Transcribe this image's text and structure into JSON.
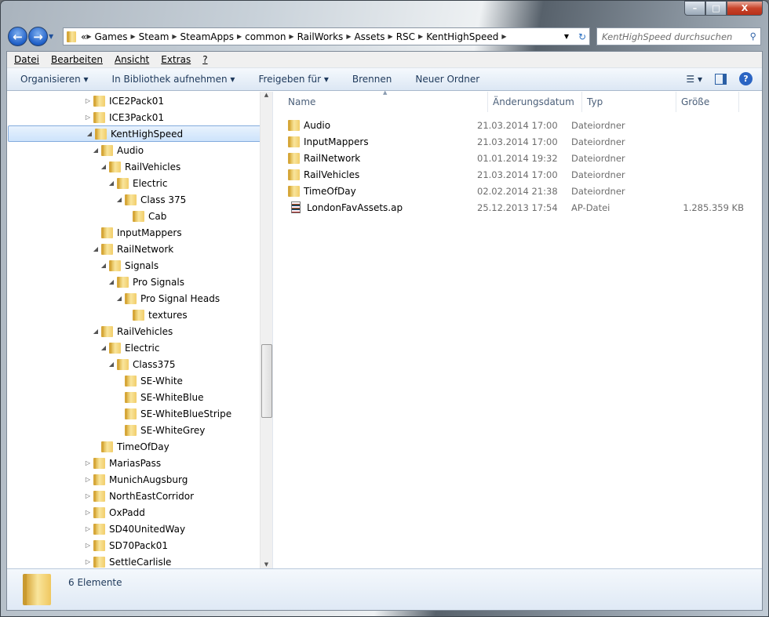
{
  "window": {
    "minimize": "–",
    "maximize": "□",
    "close": "X"
  },
  "nav": {
    "back": "←",
    "forward": "→"
  },
  "address": {
    "prefix": "«",
    "crumbs": [
      "Games",
      "Steam",
      "SteamApps",
      "common",
      "RailWorks",
      "Assets",
      "RSC",
      "KentHighSpeed"
    ]
  },
  "search": {
    "placeholder": "KentHighSpeed durchsuchen"
  },
  "menu": [
    "Datei",
    "Bearbeiten",
    "Ansicht",
    "Extras",
    "?"
  ],
  "toolbar": {
    "organize": "Organisieren ▾",
    "library": "In Bibliothek aufnehmen ▾",
    "share": "Freigeben für ▾",
    "burn": "Brennen",
    "new_folder": "Neuer Ordner"
  },
  "tree": [
    {
      "label": "ICE2Pack01",
      "level": 0,
      "state": "collapsed"
    },
    {
      "label": "ICE3Pack01",
      "level": 0,
      "state": "collapsed"
    },
    {
      "label": "KentHighSpeed",
      "level": 0,
      "state": "expanded",
      "selected": true
    },
    {
      "label": "Audio",
      "level": 1,
      "state": "expanded"
    },
    {
      "label": "RailVehicles",
      "level": 2,
      "state": "expanded"
    },
    {
      "label": "Electric",
      "level": 3,
      "state": "expanded"
    },
    {
      "label": "Class 375",
      "level": 4,
      "state": "expanded"
    },
    {
      "label": "Cab",
      "level": 5,
      "state": "none"
    },
    {
      "label": "InputMappers",
      "level": 1,
      "state": "none"
    },
    {
      "label": "RailNetwork",
      "level": 1,
      "state": "expanded"
    },
    {
      "label": "Signals",
      "level": 2,
      "state": "expanded"
    },
    {
      "label": "Pro Signals",
      "level": 3,
      "state": "expanded"
    },
    {
      "label": "Pro Signal Heads",
      "level": 4,
      "state": "expanded"
    },
    {
      "label": "textures",
      "level": 5,
      "state": "none"
    },
    {
      "label": "RailVehicles",
      "level": 1,
      "state": "expanded"
    },
    {
      "label": "Electric",
      "level": 2,
      "state": "expanded"
    },
    {
      "label": "Class375",
      "level": 3,
      "state": "expanded"
    },
    {
      "label": "SE-White",
      "level": 4,
      "state": "none"
    },
    {
      "label": "SE-WhiteBlue",
      "level": 4,
      "state": "none"
    },
    {
      "label": "SE-WhiteBlueStripe",
      "level": 4,
      "state": "none"
    },
    {
      "label": "SE-WhiteGrey",
      "level": 4,
      "state": "none"
    },
    {
      "label": "TimeOfDay",
      "level": 1,
      "state": "none"
    },
    {
      "label": "MariasPass",
      "level": 0,
      "state": "collapsed"
    },
    {
      "label": "MunichAugsburg",
      "level": 0,
      "state": "collapsed"
    },
    {
      "label": "NorthEastCorridor",
      "level": 0,
      "state": "collapsed"
    },
    {
      "label": "OxPadd",
      "level": 0,
      "state": "collapsed"
    },
    {
      "label": "SD40UnitedWay",
      "level": 0,
      "state": "collapsed"
    },
    {
      "label": "SD70Pack01",
      "level": 0,
      "state": "collapsed"
    },
    {
      "label": "SettleCarlisle",
      "level": 0,
      "state": "collapsed"
    }
  ],
  "columns": [
    "Name",
    "Änderungsdatum",
    "Typ",
    "Größe"
  ],
  "files": [
    {
      "name": "Audio",
      "date": "21.03.2014 17:00",
      "type": "Dateiordner",
      "size": "",
      "kind": "folder"
    },
    {
      "name": "InputMappers",
      "date": "21.03.2014 17:00",
      "type": "Dateiordner",
      "size": "",
      "kind": "folder"
    },
    {
      "name": "RailNetwork",
      "date": "01.01.2014 19:32",
      "type": "Dateiordner",
      "size": "",
      "kind": "folder"
    },
    {
      "name": "RailVehicles",
      "date": "21.03.2014 17:00",
      "type": "Dateiordner",
      "size": "",
      "kind": "folder"
    },
    {
      "name": "TimeOfDay",
      "date": "02.02.2014 21:38",
      "type": "Dateiordner",
      "size": "",
      "kind": "folder"
    },
    {
      "name": "LondonFavAssets.ap",
      "date": "25.12.2013 17:54",
      "type": "AP-Datei",
      "size": "1.285.359 KB",
      "kind": "file"
    }
  ],
  "status": {
    "count": "6 Elemente"
  }
}
